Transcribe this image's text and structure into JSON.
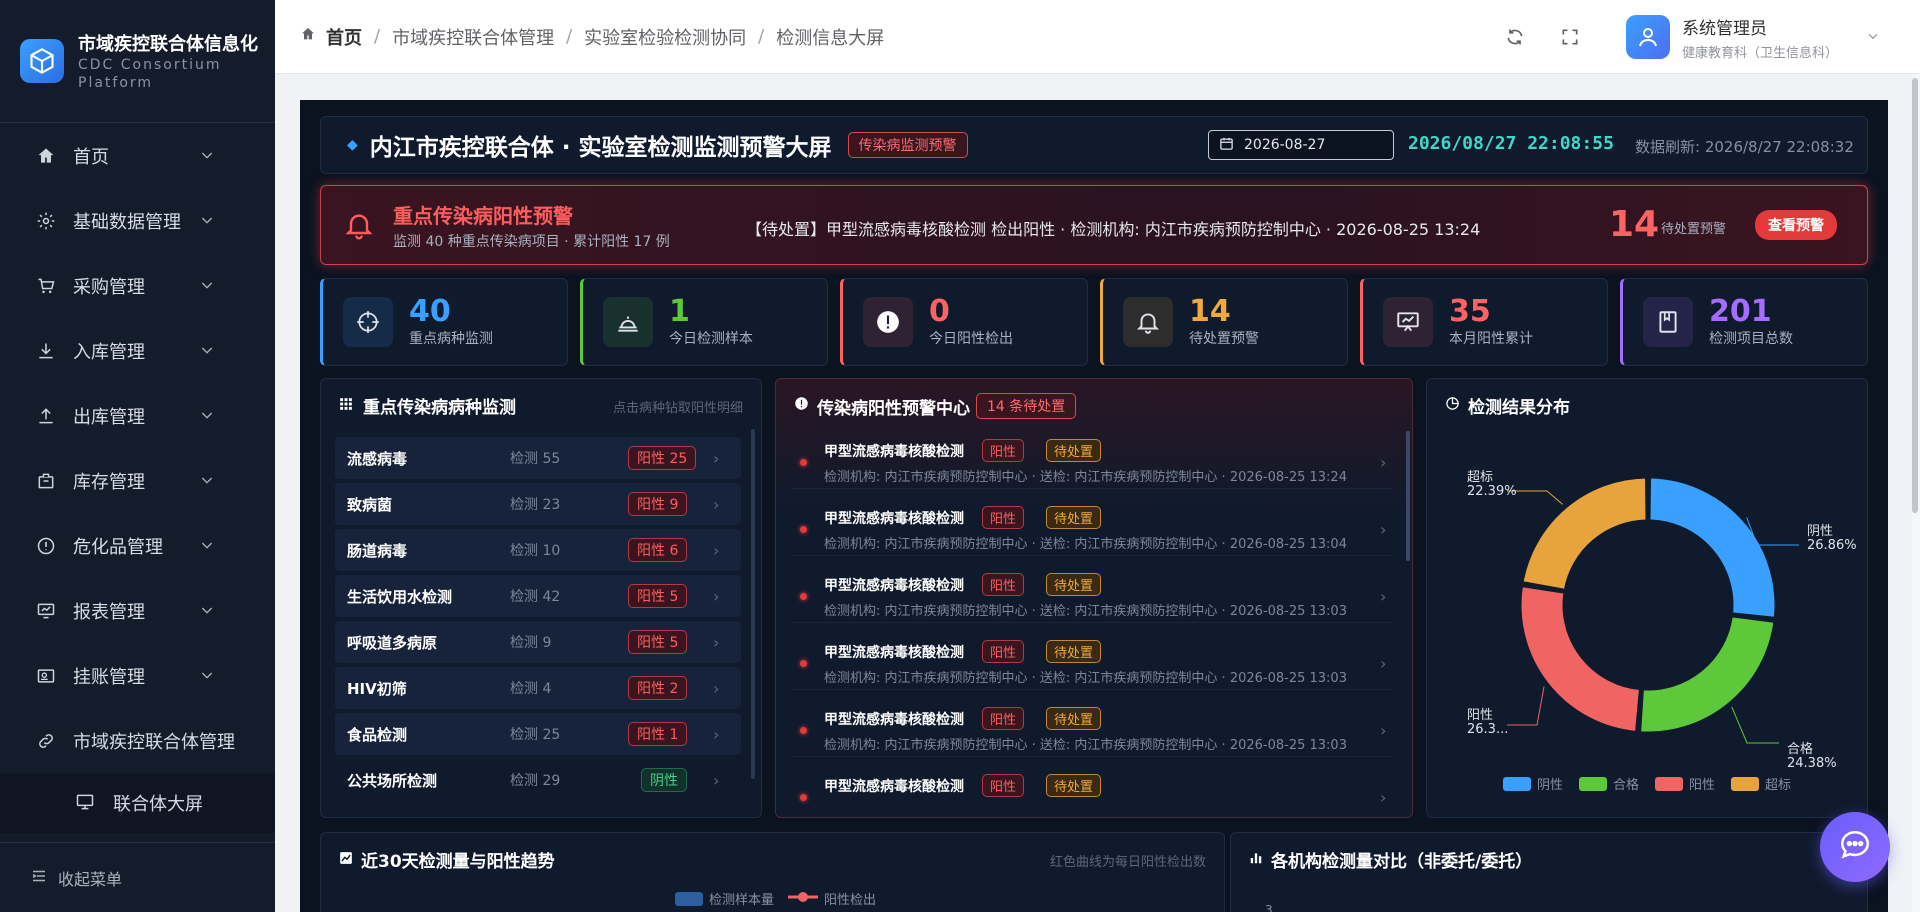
{
  "brand": {
    "title": "市域疾控联合体信息化",
    "sub1": "CDC Consortium",
    "sub2": "Platform"
  },
  "menu": [
    {
      "label": "首页",
      "icon": "home-icon"
    },
    {
      "label": "基础数据管理",
      "icon": "gear-icon"
    },
    {
      "label": "采购管理",
      "icon": "cart-icon"
    },
    {
      "label": "入库管理",
      "icon": "download-icon"
    },
    {
      "label": "出库管理",
      "icon": "upload-icon"
    },
    {
      "label": "库存管理",
      "icon": "box-icon"
    },
    {
      "label": "危化品管理",
      "icon": "warning-icon"
    },
    {
      "label": "报表管理",
      "icon": "report-icon"
    },
    {
      "label": "挂账管理",
      "icon": "ledger-icon"
    },
    {
      "label": "市域疾控联合体管理",
      "icon": "link-icon"
    }
  ],
  "submenu": {
    "label": "联合体大屏"
  },
  "collapse_label": "收起菜单",
  "breadcrumb": [
    "首页",
    "市域疾控联合体管理",
    "实验室检验检测协同",
    "检测信息大屏"
  ],
  "user": {
    "name": "系统管理员",
    "dept": "健康教育科（卫生信息科）"
  },
  "header": {
    "title": "内江市疾控联合体 · 实验室检测监测预警大屏",
    "tag": "传染病监测预警",
    "date": "2026-08-27",
    "clock": "2026/08/27 22:08:55",
    "refresh": "数据刷新: 2026/8/27 22:08:32"
  },
  "alert": {
    "title": "重点传染病阳性预警",
    "sub": "监测 40 种重点传染病项目 · 累计阳性 17 例",
    "msg": "【待处置】甲型流感病毒核酸检测 检出阳性 · 检测机构: 内江市疾病预防控制中心 · 2026-08-25 13:24",
    "count": "14",
    "count_label": "待处置预警",
    "button": "查看预警"
  },
  "kpis": [
    {
      "value": "40",
      "label": "重点病种监测",
      "color": "#3aa0ff",
      "icon": "target-icon"
    },
    {
      "value": "1",
      "label": "今日检测样本",
      "color": "#5cc83a",
      "icon": "cloche-icon"
    },
    {
      "value": "0",
      "label": "今日阳性检出",
      "color": "#ff6262",
      "icon": "alert-icon"
    },
    {
      "value": "14",
      "label": "待处置预警",
      "color": "#f0a93b",
      "icon": "bell-icon"
    },
    {
      "value": "35",
      "label": "本月阳性累计",
      "color": "#ff6262",
      "icon": "chart-board-icon"
    },
    {
      "value": "201",
      "label": "检测项目总数",
      "color": "#a66bff",
      "icon": "book-icon"
    }
  ],
  "diseases": {
    "title": "重点传染病病种监测",
    "hint": "点击病种钻取阳性明细",
    "rows": [
      {
        "name": "流感病毒",
        "count": "检测 55",
        "pos": "阳性 25",
        "ok": false
      },
      {
        "name": "致病菌",
        "count": "检测 23",
        "pos": "阳性 9",
        "ok": false
      },
      {
        "name": "肠道病毒",
        "count": "检测 10",
        "pos": "阳性 6",
        "ok": false
      },
      {
        "name": "生活饮用水检测",
        "count": "检测 42",
        "pos": "阳性 5",
        "ok": false
      },
      {
        "name": "呼吸道多病原",
        "count": "检测 9",
        "pos": "阳性 5",
        "ok": false
      },
      {
        "name": "HIV初筛",
        "count": "检测 4",
        "pos": "阳性 2",
        "ok": false
      },
      {
        "name": "食品检测",
        "count": "检测 25",
        "pos": "阳性 1",
        "ok": false
      },
      {
        "name": "公共场所检测",
        "count": "检测 29",
        "pos": "阴性",
        "ok": true
      }
    ]
  },
  "warnings": {
    "title": "传染病阳性预警中心",
    "badge": "14 条待处置",
    "rows": [
      {
        "title": "甲型流感病毒核酸检测",
        "b1": "阳性",
        "b2": "待处置",
        "meta": "检测机构: 内江市疾病预防控制中心 · 送检: 内江市疾病预防控制中心 · 2026-08-25 13:24"
      },
      {
        "title": "甲型流感病毒核酸检测",
        "b1": "阳性",
        "b2": "待处置",
        "meta": "检测机构: 内江市疾病预防控制中心 · 送检: 内江市疾病预防控制中心 · 2026-08-25 13:04"
      },
      {
        "title": "甲型流感病毒核酸检测",
        "b1": "阳性",
        "b2": "待处置",
        "meta": "检测机构: 内江市疾病预防控制中心 · 送检: 内江市疾病预防控制中心 · 2026-08-25 13:03"
      },
      {
        "title": "甲型流感病毒核酸检测",
        "b1": "阳性",
        "b2": "待处置",
        "meta": "检测机构: 内江市疾病预防控制中心 · 送检: 内江市疾病预防控制中心 · 2026-08-25 13:03"
      },
      {
        "title": "甲型流感病毒核酸检测",
        "b1": "阳性",
        "b2": "待处置",
        "meta": "检测机构: 内江市疾病预防控制中心 · 送检: 内江市疾病预防控制中心 · 2026-08-25 13:03"
      },
      {
        "title": "甲型流感病毒核酸检测",
        "b1": "阳性",
        "b2": "待处置",
        "meta": ""
      }
    ]
  },
  "distribution": {
    "title": "检测结果分布"
  },
  "chart_data": {
    "type": "pie",
    "donut": true,
    "slices": [
      {
        "name": "阴性",
        "value": 26.86,
        "label": "阴性",
        "pct": "26.86%",
        "color": "#3aa0ff"
      },
      {
        "name": "合格",
        "value": 24.38,
        "label": "合格",
        "pct": "24.38%",
        "color": "#5cc83a"
      },
      {
        "name": "阳性",
        "value": 26.37,
        "label": "阳性",
        "pct": "26.3...",
        "color": "#f06464"
      },
      {
        "name": "超标",
        "value": 22.39,
        "label": "超标",
        "pct": "22.39%",
        "color": "#e8a43c"
      }
    ],
    "legend": "bottom"
  },
  "trend": {
    "title": "近30天检测量与阳性趋势",
    "hint": "红色曲线为每日阳性检出数",
    "legend_bar": "检测样本量",
    "legend_line": "阳性检出"
  },
  "compare": {
    "title": "各机构检测量对比（非委托/委托）",
    "tick": "3"
  }
}
